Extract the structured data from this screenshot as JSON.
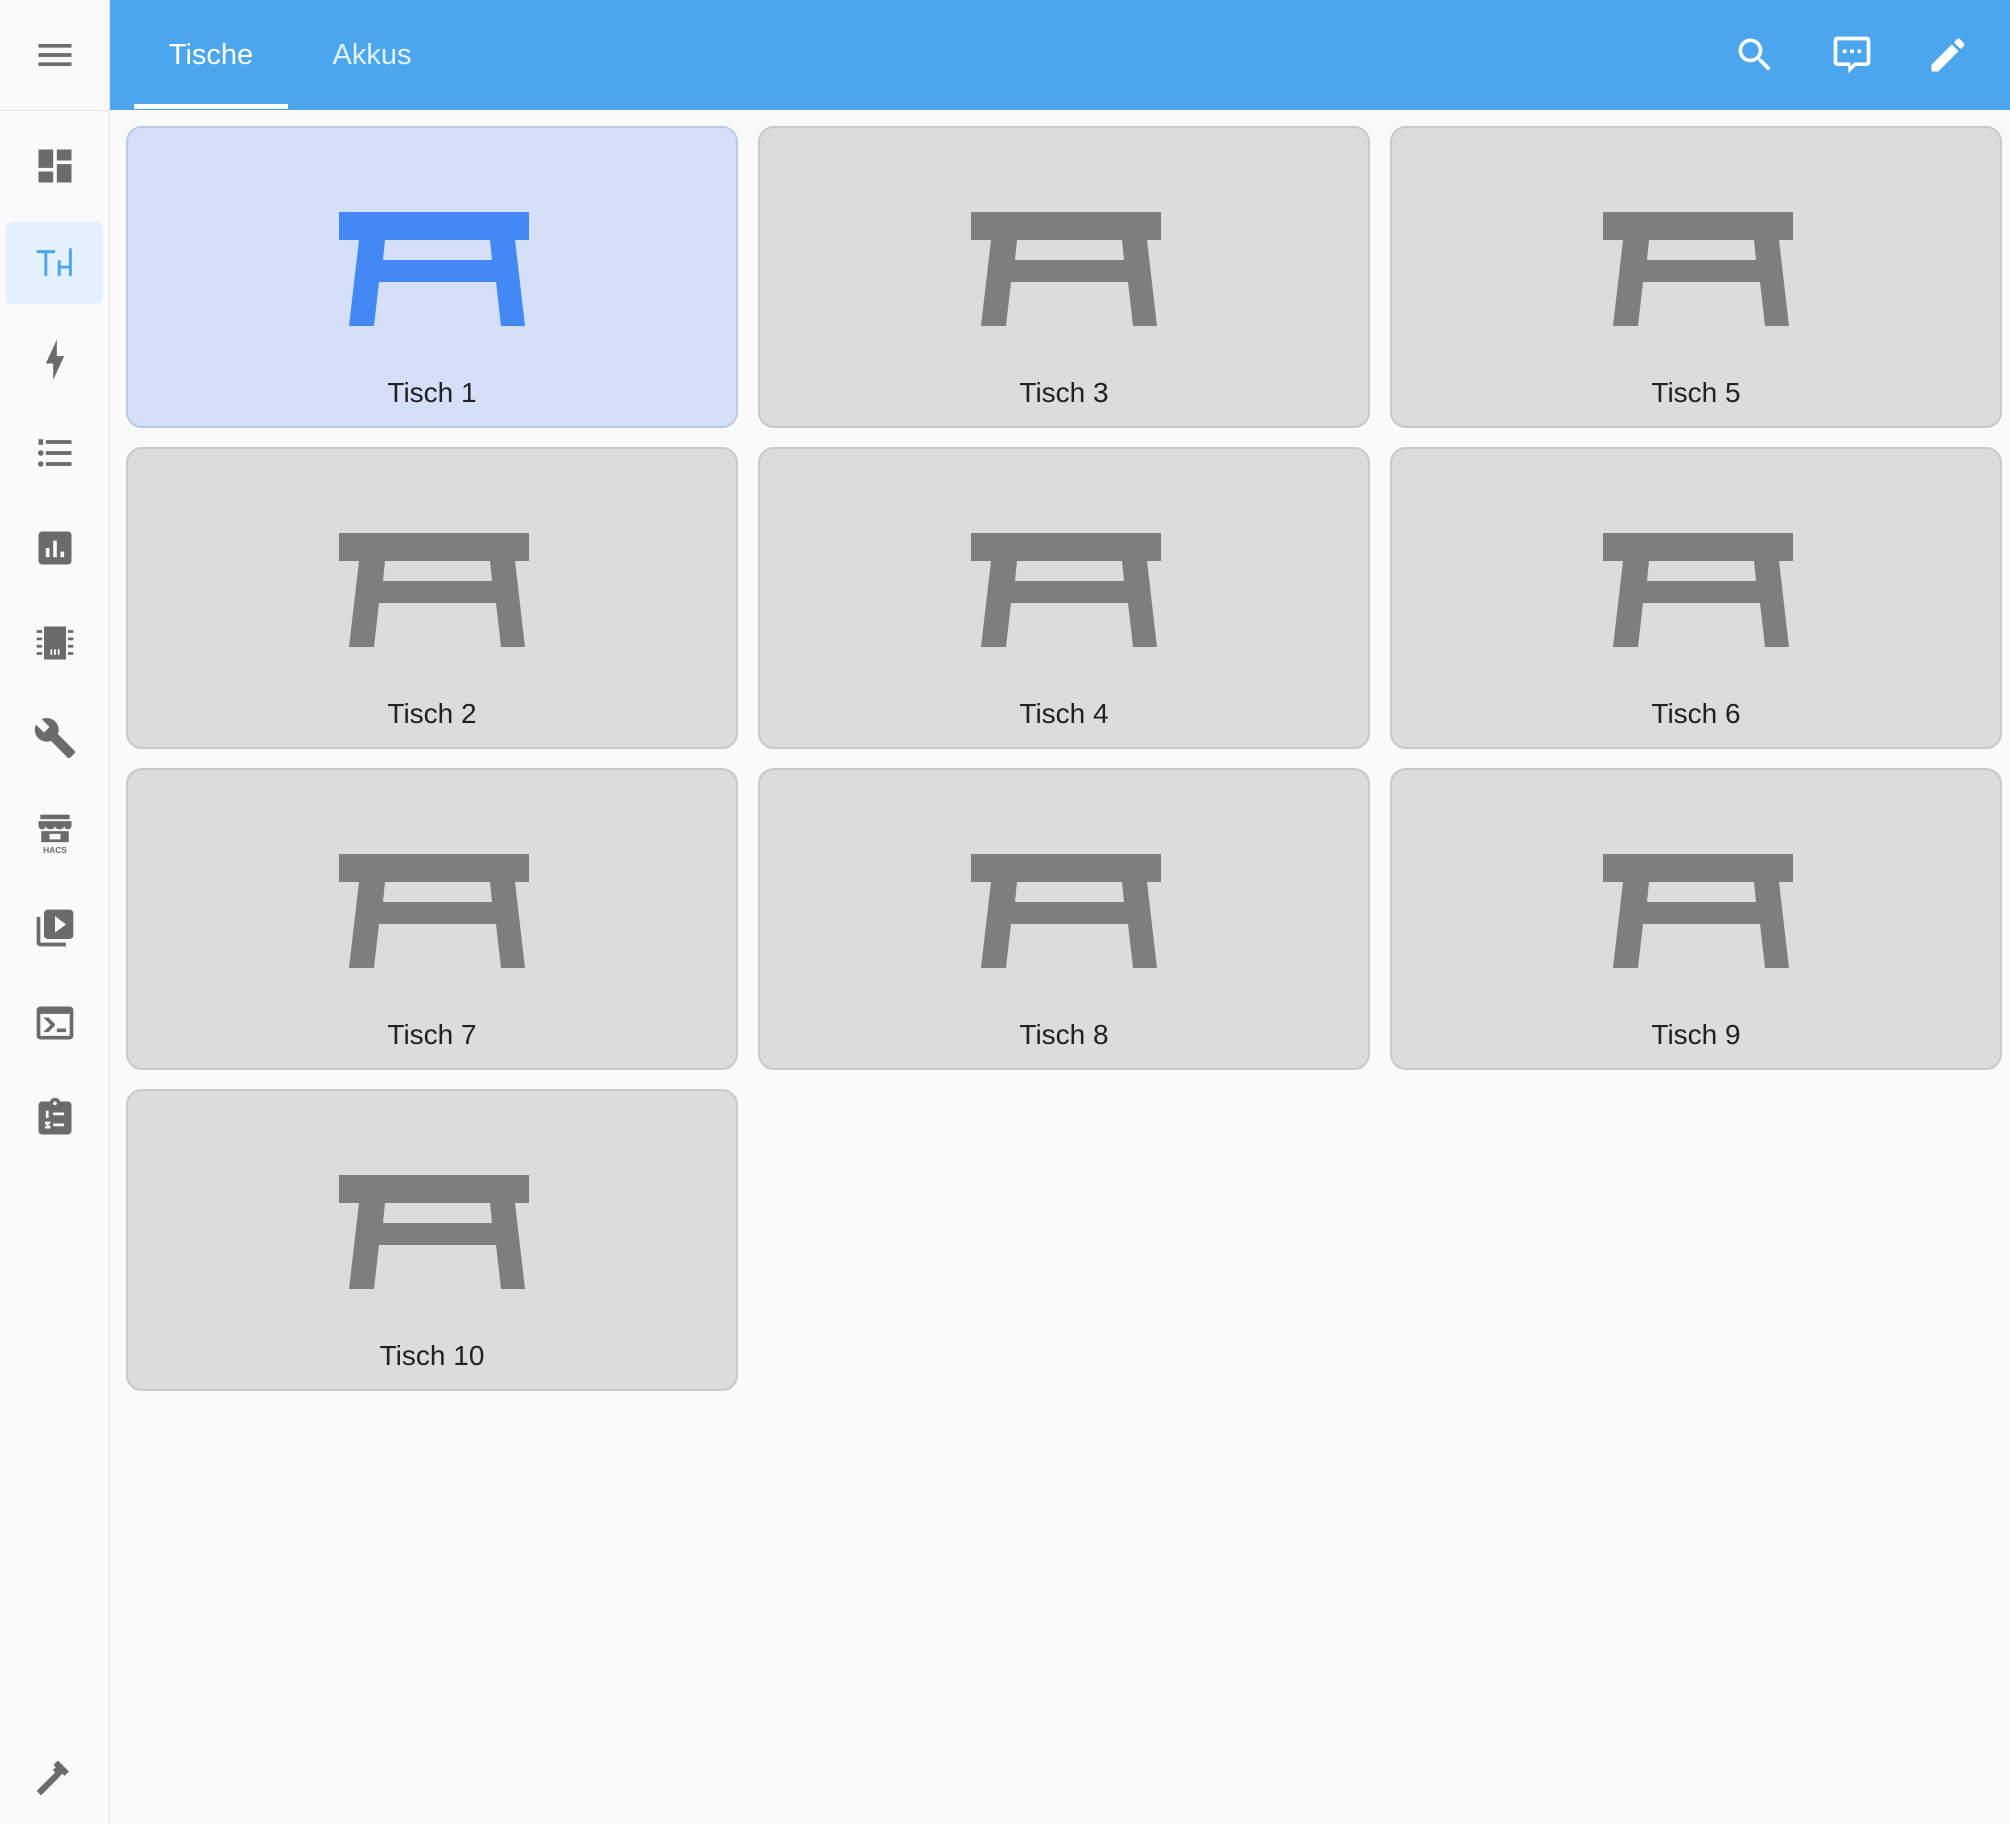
{
  "sidebar": {
    "items": [
      {
        "name": "overview",
        "icon": "dashboard-icon",
        "active": false
      },
      {
        "name": "tische",
        "icon": "table-furniture-icon",
        "active": true
      },
      {
        "name": "energy",
        "icon": "lightning-bolt-icon",
        "active": false
      },
      {
        "name": "logbook",
        "icon": "format-list-icon",
        "active": false
      },
      {
        "name": "history",
        "icon": "chart-box-icon",
        "active": false
      },
      {
        "name": "esphome",
        "icon": "chip-icon",
        "active": false
      },
      {
        "name": "settings",
        "icon": "wrench-icon",
        "active": false
      },
      {
        "name": "hacs",
        "icon": "hacs-store-icon",
        "active": false,
        "badge_text": "HACS"
      },
      {
        "name": "media",
        "icon": "play-box-multiple-icon",
        "active": false
      },
      {
        "name": "terminal",
        "icon": "console-icon",
        "active": false
      },
      {
        "name": "todo",
        "icon": "clipboard-list-icon",
        "active": false
      }
    ],
    "bottom_icon": "hammer-icon"
  },
  "header": {
    "tabs": [
      {
        "label": "Tische",
        "active": true
      },
      {
        "label": "Akkus",
        "active": false
      }
    ],
    "actions": [
      "search-icon",
      "assist-message-icon",
      "edit-pencil-icon"
    ]
  },
  "cards": [
    {
      "label": "Tisch 1",
      "active": true
    },
    {
      "label": "Tisch 3",
      "active": false
    },
    {
      "label": "Tisch 5",
      "active": false
    },
    {
      "label": "Tisch 2",
      "active": false
    },
    {
      "label": "Tisch 4",
      "active": false
    },
    {
      "label": "Tisch 6",
      "active": false
    },
    {
      "label": "Tisch 7",
      "active": false
    },
    {
      "label": "Tisch 8",
      "active": false
    },
    {
      "label": "Tisch 9",
      "active": false
    },
    {
      "label": "Tisch 10",
      "active": false
    }
  ],
  "colors": {
    "header": "#4ba6ee",
    "accent": "#4289f5",
    "icon_inactive": "#7e7e7e",
    "sidebar_icon": "#6b6b6b",
    "card_bg": "#dcdcdc",
    "card_active_bg": "#d3e0f8"
  }
}
